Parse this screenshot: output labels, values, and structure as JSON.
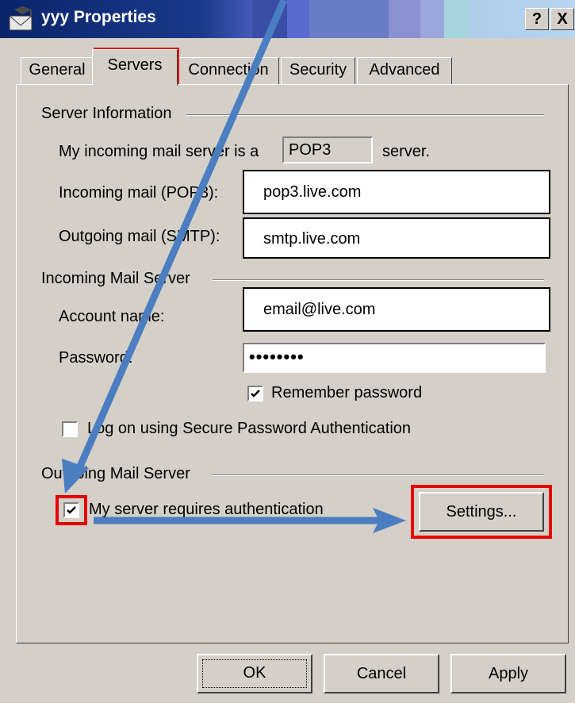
{
  "window": {
    "title": "yyy Properties",
    "help_btn": "?",
    "close_btn": "X"
  },
  "tabs": [
    "General",
    "Servers",
    "Connection",
    "Security",
    "Advanced"
  ],
  "server_info": {
    "group_label": "Server Information",
    "incoming_type_label": "My incoming mail server is a",
    "incoming_type_value": "POP3",
    "incoming_type_suffix": "server.",
    "incoming_label": "Incoming mail (POP3):",
    "incoming_value": "pop3.live.com",
    "outgoing_label": "Outgoing mail (SMTP):",
    "outgoing_value": "smtp.live.com"
  },
  "incoming_server": {
    "group_label": "Incoming Mail Server",
    "account_label": "Account name:",
    "account_value": "email@live.com",
    "password_label": "Password:",
    "password_value": "••••••••",
    "remember_label": "Remember password",
    "remember_checked": true,
    "spa_label": "Log on using Secure Password Authentication",
    "spa_checked": false
  },
  "outgoing_server": {
    "group_label": "Outgoing Mail Server",
    "auth_label": "My server requires authentication",
    "auth_checked": true,
    "settings_button": "Settings..."
  },
  "footer": {
    "ok": "OK",
    "cancel": "Cancel",
    "apply": "Apply"
  },
  "colors": {
    "highlight": "#e60000",
    "arrow": "#4a7ec0",
    "title_bar": "#0a246a"
  }
}
